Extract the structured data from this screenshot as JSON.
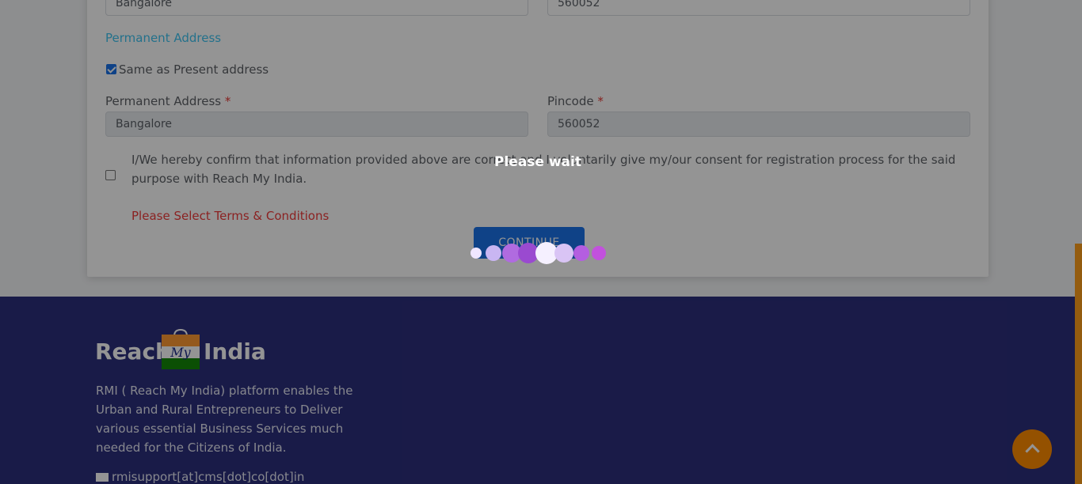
{
  "form": {
    "present_city_value": "Bangalore",
    "present_pincode_value": "560052",
    "permanent_section_title": "Permanent Address",
    "same_as_present_label": "Same as Present address",
    "same_as_present_checked": true,
    "permanent_address_label": "Permanent Address",
    "permanent_address_value": "Bangalore",
    "pincode_label": "Pincode",
    "pincode_value": "560052",
    "required_marker": "*",
    "consent_text": "I/We hereby confirm that information provided above are correct and I voluntarily give my/our consent for registration process for the said purpose with Reach My India.",
    "consent_checked": false,
    "error_text": "Please Select Terms & Conditions",
    "continue_label": "CONTINUE"
  },
  "footer": {
    "logo_left": "Reach",
    "logo_bag_text": "My",
    "logo_right": "India",
    "description": "RMI ( Reach My India) platform enables the Urban and Rural Entrepreneurs to Deliver various essential Business Services much needed for the Citizens of India.",
    "email": "rmisupport[at]cms[dot]co[dot]in",
    "email_icon": "envelope-icon"
  },
  "back_to_top_icon": "chevron-up-icon",
  "loading": {
    "text": "Please wait"
  },
  "colors": {
    "accent_blue": "#1a73e8",
    "section_title": "#3ec3f0",
    "error": "#ef3b3b",
    "footer_bg": "#2c2f7c",
    "orange": "#ff8c00"
  }
}
